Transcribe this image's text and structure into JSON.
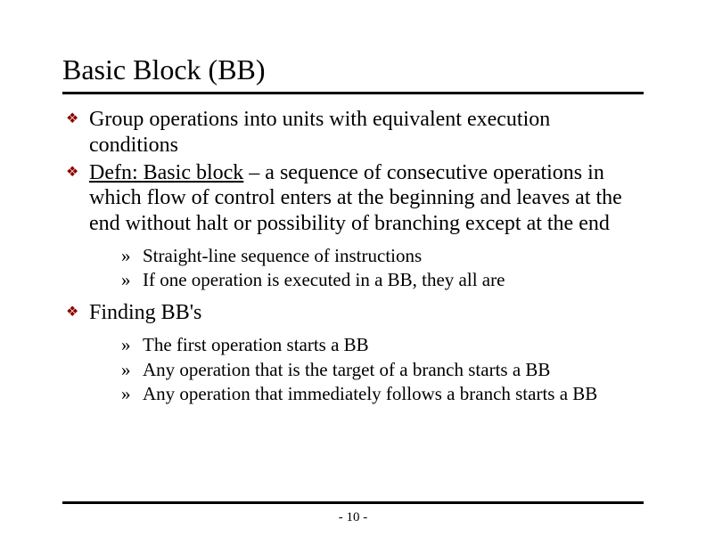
{
  "title": "Basic Block (BB)",
  "bullets": [
    {
      "text": "Group operations into units with equivalent execution conditions",
      "sub": []
    },
    {
      "defn_label": "Defn: Basic block",
      "text_rest": " – a sequence of consecutive operations in which flow of control enters at the beginning and leaves at the end without halt or possibility of branching except at the end",
      "sub": [
        "Straight-line sequence of instructions",
        "If one operation is executed in a BB, they all are"
      ]
    },
    {
      "text": "Finding BB's",
      "sub": [
        "The first operation starts a BB",
        "Any operation that is the target of a branch starts a BB",
        "Any operation that immediately follows a branch starts a BB"
      ]
    }
  ],
  "page_number": "- 10 -",
  "icons": {
    "main_bullet": "❖",
    "sub_bullet": "»"
  }
}
